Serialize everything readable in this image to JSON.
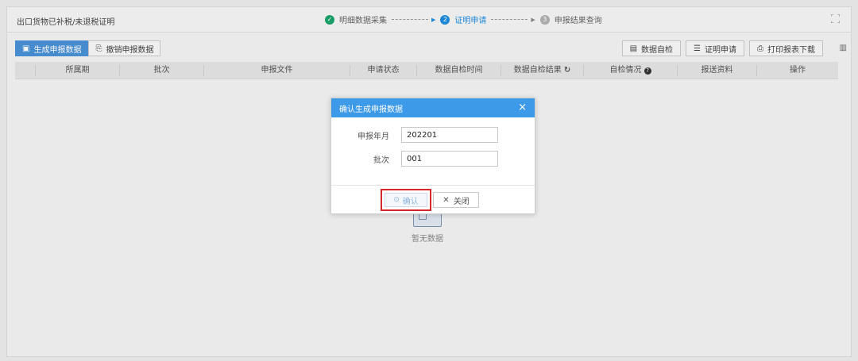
{
  "page": {
    "title": "出口货物已补税/未退税证明"
  },
  "steps": [
    {
      "num": "✓",
      "label": "明细数据采集",
      "state": "done"
    },
    {
      "num": "2",
      "label": "证明申请",
      "state": "active"
    },
    {
      "num": "3",
      "label": "申报结果查询",
      "state": "todo"
    }
  ],
  "toolbar": {
    "generate_label": "生成申报数据",
    "revoke_label": "撤销申报数据",
    "selfcheck_label": "数据自检",
    "apply_label": "证明申请",
    "print_label": "打印报表下载"
  },
  "table": {
    "columns": [
      "所属期",
      "批次",
      "申报文件",
      "申请状态",
      "数据自检时间",
      "数据自检结果",
      "自检情况",
      "报送资料",
      "操作"
    ],
    "empty_text": "暂无数据"
  },
  "dialog": {
    "title": "确认生成申报数据",
    "period_label": "申报年月",
    "period_value": "202201",
    "batch_label": "批次",
    "batch_value": "001",
    "confirm_label": "确认",
    "close_label": "关闭"
  },
  "colors": {
    "accent": "#3d9ae8",
    "primary_button": "#4a90d6",
    "highlight_border": "#d9262b",
    "step_done": "#1aa36b"
  }
}
